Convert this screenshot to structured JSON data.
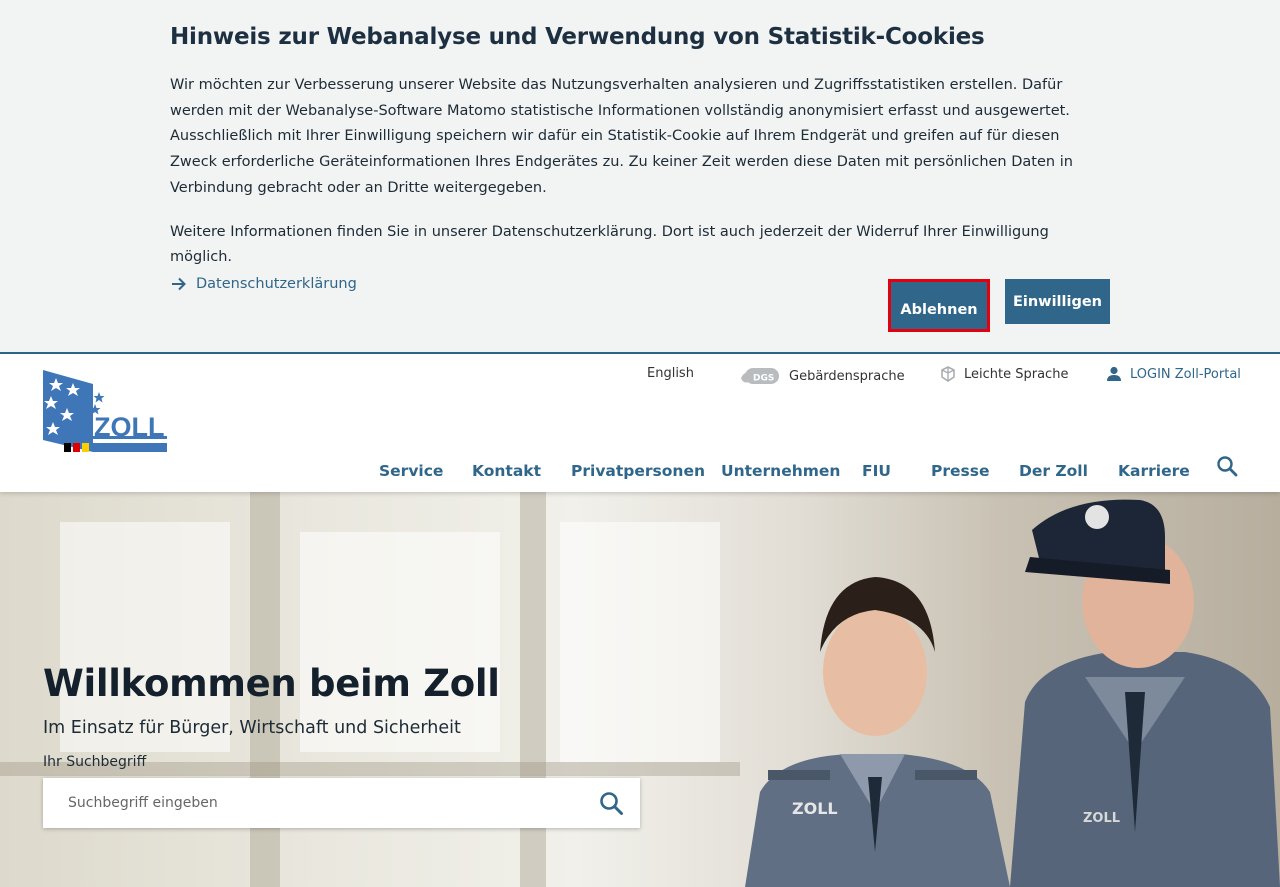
{
  "cookie_banner": {
    "title": "Hinweis zur Webanalyse und Verwendung von Statistik-Cookies",
    "paragraph1": "Wir möchten zur Verbesserung unserer Website das Nutzungsverhalten analysieren und Zugriffsstatistiken erstellen. Dafür werden mit der Webanalyse-Software Matomo statistische Informationen vollständig anonymisiert erfasst und ausgewertet. Ausschließlich mit Ihrer Einwilli­gung speichern wir dafür ein Statistik-Cookie auf Ihrem Endgerät und greifen auf für diesen Zweck erforderliche Geräteinformationen Ihres End­gerätes zu. Zu keiner Zeit werden diese Daten mit persönlichen Daten in Verbindung gebracht oder an Dritte weitergegeben.",
    "paragraph2": "Weitere Informationen finden Sie in unserer Datenschutzerklärung. Dort ist auch jederzeit der Widerruf Ihrer Einwilligung möglich.",
    "privacy_link": "Datenschutzerklärung",
    "decline_label": "Ablehnen",
    "accept_label": "Einwilligen"
  },
  "header": {
    "logo_text": "ZOLL",
    "top_nav": {
      "english": "English",
      "sign_language_badge": "DGS",
      "sign_language": "Gebärdensprache",
      "easy_language": "Leichte Sprache",
      "login": "LOGIN Zoll-Portal"
    },
    "main_nav": [
      "Service",
      "Kontakt",
      "Privatpersonen",
      "Unternehmen",
      "FIU",
      "Presse",
      "Der Zoll",
      "Karriere"
    ]
  },
  "hero": {
    "title": "Willkommen beim Zoll",
    "subtitle": "Im Einsatz für Bürger, Wirtschaft und Sicherheit",
    "search_label": "Ihr Suchbegriff",
    "search_placeholder": "Suchbegriff eingeben",
    "badge_text": "ZOLL"
  },
  "colors": {
    "brand_blue": "#2f6689",
    "highlight_red": "#e3000f",
    "banner_bg": "#f2f3f3"
  },
  "icons": {
    "privacy_link": "arrow-right-icon",
    "sign_language": "sign-language-icon",
    "easy_language": "easy-language-icon",
    "login": "user-icon",
    "search": "search-icon"
  }
}
